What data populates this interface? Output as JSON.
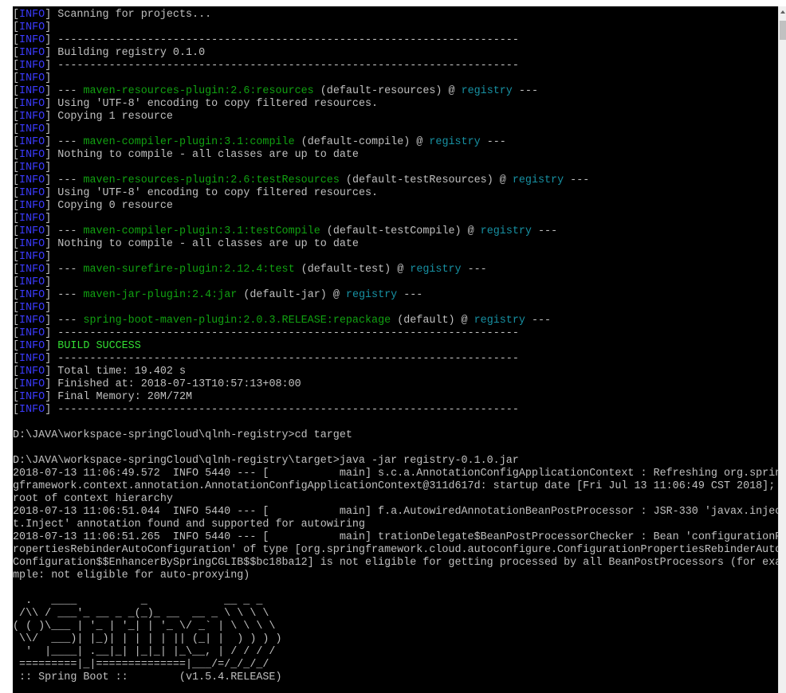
{
  "info_tag": "INFO",
  "log": [
    {
      "k": "info",
      "parts": [
        [
          "t",
          "Scanning for projects..."
        ]
      ]
    },
    {
      "k": "info",
      "parts": []
    },
    {
      "k": "info",
      "parts": [
        [
          "t",
          "------------------------------------------------------------------------"
        ]
      ]
    },
    {
      "k": "info",
      "parts": [
        [
          "t",
          "Building registry 0.1.0"
        ]
      ]
    },
    {
      "k": "info",
      "parts": [
        [
          "t",
          "------------------------------------------------------------------------"
        ]
      ]
    },
    {
      "k": "info",
      "parts": []
    },
    {
      "k": "info",
      "parts": [
        [
          "t",
          "--- "
        ],
        [
          "g",
          "maven-resources-plugin:2.6:resources"
        ],
        [
          "t",
          " (default-resources) @ "
        ],
        [
          "c",
          "registry"
        ],
        [
          "t",
          " ---"
        ]
      ]
    },
    {
      "k": "info",
      "parts": [
        [
          "t",
          "Using 'UTF-8' encoding to copy filtered resources."
        ]
      ]
    },
    {
      "k": "info",
      "parts": [
        [
          "t",
          "Copying 1 resource"
        ]
      ]
    },
    {
      "k": "info",
      "parts": []
    },
    {
      "k": "info",
      "parts": [
        [
          "t",
          "--- "
        ],
        [
          "g",
          "maven-compiler-plugin:3.1:compile"
        ],
        [
          "t",
          " (default-compile) @ "
        ],
        [
          "c",
          "registry"
        ],
        [
          "t",
          " ---"
        ]
      ]
    },
    {
      "k": "info",
      "parts": [
        [
          "t",
          "Nothing to compile - all classes are up to date"
        ]
      ]
    },
    {
      "k": "info",
      "parts": []
    },
    {
      "k": "info",
      "parts": [
        [
          "t",
          "--- "
        ],
        [
          "g",
          "maven-resources-plugin:2.6:testResources"
        ],
        [
          "t",
          " (default-testResources) @ "
        ],
        [
          "c",
          "registry"
        ],
        [
          "t",
          " ---"
        ]
      ]
    },
    {
      "k": "info",
      "parts": [
        [
          "t",
          "Using 'UTF-8' encoding to copy filtered resources."
        ]
      ]
    },
    {
      "k": "info",
      "parts": [
        [
          "t",
          "Copying 0 resource"
        ]
      ]
    },
    {
      "k": "info",
      "parts": []
    },
    {
      "k": "info",
      "parts": [
        [
          "t",
          "--- "
        ],
        [
          "g",
          "maven-compiler-plugin:3.1:testCompile"
        ],
        [
          "t",
          " (default-testCompile) @ "
        ],
        [
          "c",
          "registry"
        ],
        [
          "t",
          " ---"
        ]
      ]
    },
    {
      "k": "info",
      "parts": [
        [
          "t",
          "Nothing to compile - all classes are up to date"
        ]
      ]
    },
    {
      "k": "info",
      "parts": []
    },
    {
      "k": "info",
      "parts": [
        [
          "t",
          "--- "
        ],
        [
          "g",
          "maven-surefire-plugin:2.12.4:test"
        ],
        [
          "t",
          " (default-test) @ "
        ],
        [
          "c",
          "registry"
        ],
        [
          "t",
          " ---"
        ]
      ]
    },
    {
      "k": "info",
      "parts": []
    },
    {
      "k": "info",
      "parts": [
        [
          "t",
          "--- "
        ],
        [
          "g",
          "maven-jar-plugin:2.4:jar"
        ],
        [
          "t",
          " (default-jar) @ "
        ],
        [
          "c",
          "registry"
        ],
        [
          "t",
          " ---"
        ]
      ]
    },
    {
      "k": "info",
      "parts": []
    },
    {
      "k": "info",
      "parts": [
        [
          "t",
          "--- "
        ],
        [
          "g",
          "spring-boot-maven-plugin:2.0.3.RELEASE:repackage"
        ],
        [
          "t",
          " (default) @ "
        ],
        [
          "c",
          "registry"
        ],
        [
          "t",
          " ---"
        ]
      ]
    },
    {
      "k": "info",
      "parts": [
        [
          "t",
          "------------------------------------------------------------------------"
        ]
      ]
    },
    {
      "k": "info",
      "parts": [
        [
          "b",
          "BUILD SUCCESS"
        ]
      ]
    },
    {
      "k": "info",
      "parts": [
        [
          "t",
          "------------------------------------------------------------------------"
        ]
      ]
    },
    {
      "k": "info",
      "parts": [
        [
          "t",
          "Total time: 19.402 s"
        ]
      ]
    },
    {
      "k": "info",
      "parts": [
        [
          "t",
          "Finished at: 2018-07-13T10:57:13+08:00"
        ]
      ]
    },
    {
      "k": "info",
      "parts": [
        [
          "t",
          "Final Memory: 20M/72M"
        ]
      ]
    },
    {
      "k": "info",
      "parts": [
        [
          "t",
          "------------------------------------------------------------------------"
        ]
      ]
    },
    {
      "k": "blank"
    },
    {
      "k": "plain",
      "text": "D:\\JAVA\\workspace-springCloud\\qlnh-registry>cd target"
    },
    {
      "k": "blank"
    },
    {
      "k": "plain",
      "text": "D:\\JAVA\\workspace-springCloud\\qlnh-registry\\target>java -jar registry-0.1.0.jar"
    },
    {
      "k": "plain",
      "text": "2018-07-13 11:06:49.572  INFO 5440 --- [           main] s.c.a.AnnotationConfigApplicationContext : Refreshing org.sprin"
    },
    {
      "k": "plain",
      "text": "gframework.context.annotation.AnnotationConfigApplicationContext@311d617d: startup date [Fri Jul 13 11:06:49 CST 2018];"
    },
    {
      "k": "plain",
      "text": "root of context hierarchy"
    },
    {
      "k": "plain",
      "text": "2018-07-13 11:06:51.044  INFO 5440 --- [           main] f.a.AutowiredAnnotationBeanPostProcessor : JSR-330 'javax.injec"
    },
    {
      "k": "plain",
      "text": "t.Inject' annotation found and supported for autowiring"
    },
    {
      "k": "plain",
      "text": "2018-07-13 11:06:51.265  INFO 5440 --- [           main] trationDelegate$BeanPostProcessorChecker : Bean 'configurationP"
    },
    {
      "k": "plain",
      "text": "ropertiesRebinderAutoConfiguration' of type [org.springframework.cloud.autoconfigure.ConfigurationPropertiesRebinderAuto"
    },
    {
      "k": "plain",
      "text": "Configuration$$EnhancerBySpringCGLIB$$bc18ba12] is not eligible for getting processed by all BeanPostProcessors (for exa"
    },
    {
      "k": "plain",
      "text": "mple: not eligible for auto-proxying)"
    },
    {
      "k": "blank"
    },
    {
      "k": "plain",
      "text": "  .   ____          _            __ _ _"
    },
    {
      "k": "plain",
      "text": " /\\\\ / ___'_ __ _ _(_)_ __  __ _ \\ \\ \\ \\"
    },
    {
      "k": "plain",
      "text": "( ( )\\___ | '_ | '_| | '_ \\/ _` | \\ \\ \\ \\"
    },
    {
      "k": "plain",
      "text": " \\\\/  ___)| |_)| | | | | || (_| |  ) ) ) )"
    },
    {
      "k": "plain",
      "text": "  '  |____| .__|_| |_|_| |_\\__, | / / / /"
    },
    {
      "k": "plain",
      "text": " =========|_|==============|___/=/_/_/_/"
    },
    {
      "k": "plain",
      "text": " :: Spring Boot ::        (v1.5.4.RELEASE)"
    }
  ]
}
